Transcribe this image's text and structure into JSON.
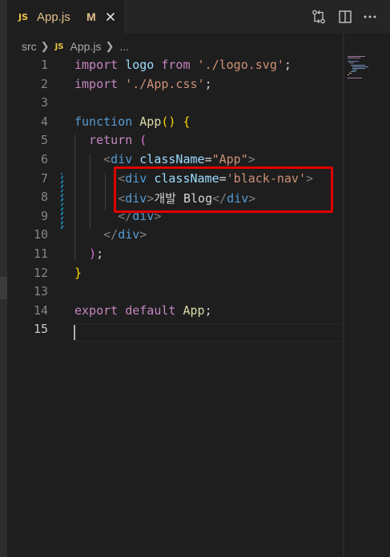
{
  "tab": {
    "icon_label": "JS",
    "filename": "App.js",
    "modified_marker": "M",
    "close_icon": "close-icon"
  },
  "toolbar_icons": [
    "git-compare-icon",
    "split-editor-icon",
    "more-actions-icon"
  ],
  "breadcrumb": {
    "folder": "src",
    "file_icon_label": "JS",
    "file": "App.js",
    "symbol": "..."
  },
  "editor": {
    "active_line": 15,
    "line_numbers": [
      "1",
      "2",
      "3",
      "4",
      "5",
      "6",
      "7",
      "8",
      "9",
      "10",
      "11",
      "12",
      "13",
      "14",
      "15"
    ],
    "lines": [
      [
        [
          "kw",
          "import "
        ],
        [
          "var",
          "logo "
        ],
        [
          "kw",
          "from "
        ],
        [
          "str",
          "'./logo.svg'"
        ],
        [
          "txt",
          ";"
        ]
      ],
      [
        [
          "kw",
          "import "
        ],
        [
          "str",
          "'./App.css'"
        ],
        [
          "txt",
          ";"
        ]
      ],
      [],
      [
        [
          "ctl",
          "function "
        ],
        [
          "fn",
          "App"
        ],
        [
          "pb2",
          "() "
        ],
        [
          "pb2",
          "{"
        ]
      ],
      [
        [
          "txt",
          "  "
        ],
        [
          "kw",
          "return "
        ],
        [
          "pb",
          "("
        ]
      ],
      [
        [
          "txt",
          "    "
        ],
        [
          "punc",
          "<"
        ],
        [
          "tag",
          "div "
        ],
        [
          "attr",
          "className"
        ],
        [
          "txt",
          "="
        ],
        [
          "str",
          "\"App\""
        ],
        [
          "punc",
          ">"
        ]
      ],
      [
        [
          "txt",
          "      "
        ],
        [
          "punc",
          "<"
        ],
        [
          "tag",
          "div "
        ],
        [
          "attr",
          "className"
        ],
        [
          "txt",
          "="
        ],
        [
          "str",
          "'black-nav'"
        ],
        [
          "punc",
          ">"
        ]
      ],
      [
        [
          "txt",
          "      "
        ],
        [
          "punc",
          "<"
        ],
        [
          "tag",
          "div"
        ],
        [
          "punc",
          ">"
        ],
        [
          "txt",
          "개발 Blog"
        ],
        [
          "punc",
          "</"
        ],
        [
          "tag",
          "div"
        ],
        [
          "punc",
          ">"
        ]
      ],
      [
        [
          "txt",
          "      "
        ],
        [
          "punc",
          "</"
        ],
        [
          "tag",
          "div"
        ],
        [
          "punc",
          ">"
        ]
      ],
      [
        [
          "txt",
          "    "
        ],
        [
          "punc",
          "</"
        ],
        [
          "tag",
          "div"
        ],
        [
          "punc",
          ">"
        ]
      ],
      [
        [
          "txt",
          "  "
        ],
        [
          "pb",
          ")"
        ],
        [
          "txt",
          ";"
        ]
      ],
      [
        [
          "pb2",
          "}"
        ]
      ],
      [],
      [
        [
          "kw",
          "export "
        ],
        [
          "kw",
          "default "
        ],
        [
          "fn",
          "App"
        ],
        [
          "txt",
          ";"
        ]
      ],
      []
    ]
  },
  "colors": {
    "editor_bg": "#1e1e1e",
    "tab_bar_bg": "#252526",
    "highlight_box": "#e00000",
    "js_icon": "#e8c145",
    "modified_text": "#e2c08d"
  }
}
